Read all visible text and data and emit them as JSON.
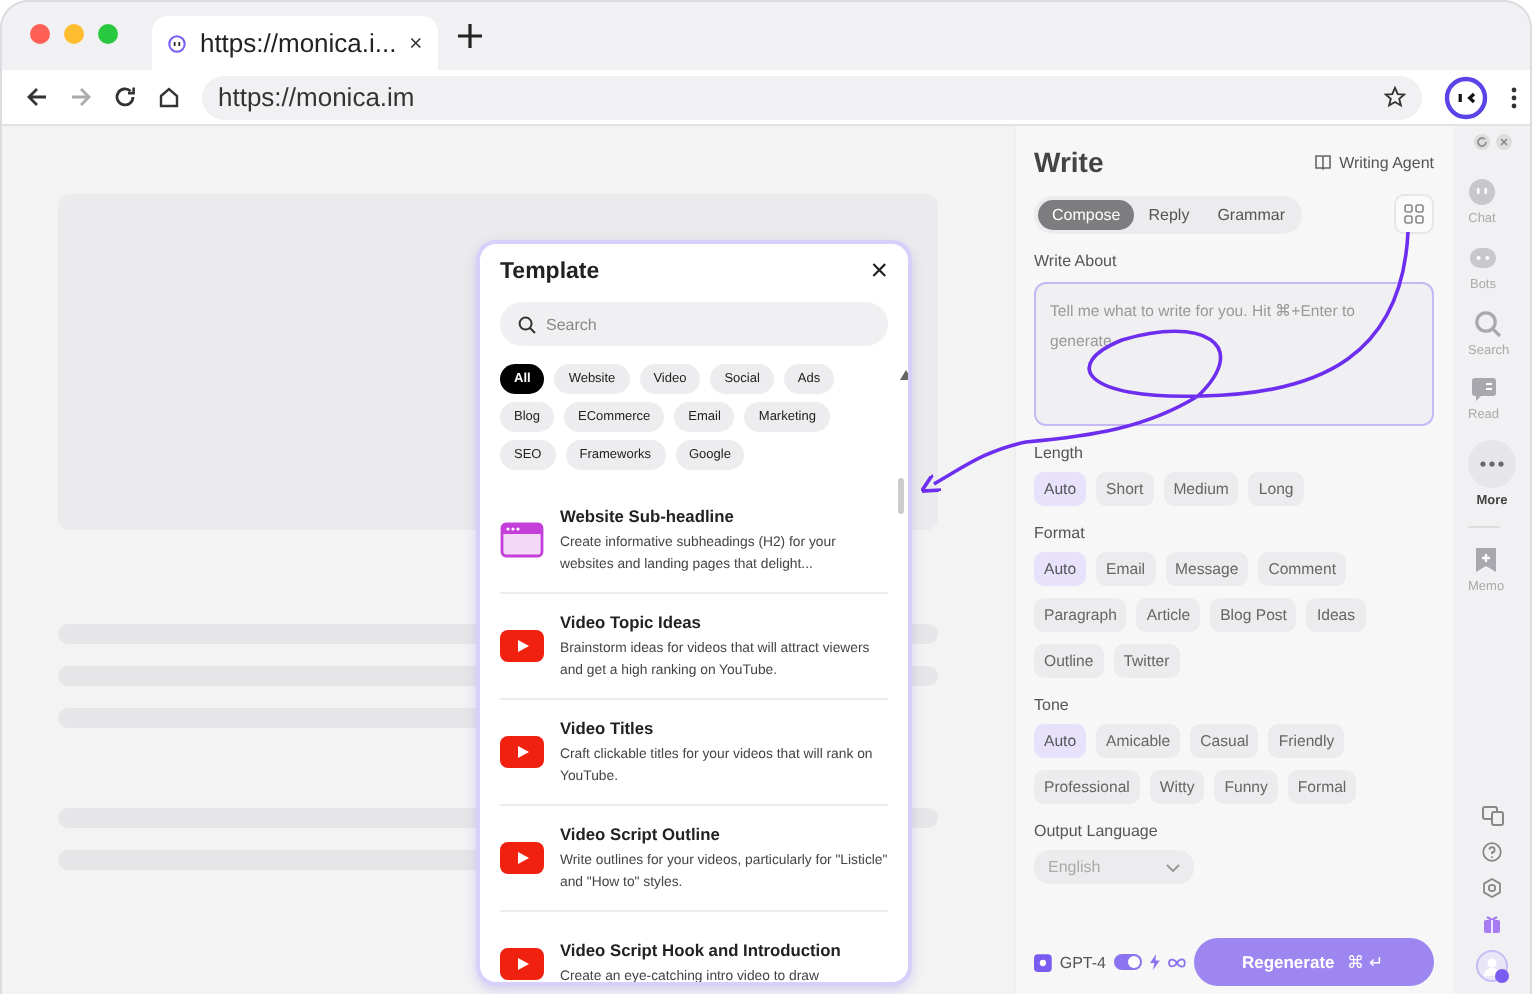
{
  "browser": {
    "tab_title": "https://monica.i...",
    "url": "https://monica.im"
  },
  "template_dialog": {
    "title": "Template",
    "close": "×",
    "search_placeholder": "Search",
    "filters": [
      {
        "label": "All",
        "selected": true
      },
      {
        "label": "Website",
        "selected": false
      },
      {
        "label": "Video",
        "selected": false
      },
      {
        "label": "Social",
        "selected": false
      },
      {
        "label": "Ads",
        "selected": false
      },
      {
        "label": "Blog",
        "selected": false
      },
      {
        "label": "ECommerce",
        "selected": false
      },
      {
        "label": "Email",
        "selected": false
      },
      {
        "label": "Marketing",
        "selected": false
      },
      {
        "label": "SEO",
        "selected": false
      },
      {
        "label": "Frameworks",
        "selected": false
      },
      {
        "label": "Google",
        "selected": false
      }
    ],
    "items": [
      {
        "kind": "website",
        "title": "Website Sub-headline",
        "description": "Create informative subheadings (H2) for your websites and landing pages that delight..."
      },
      {
        "kind": "video",
        "title": "Video Topic Ideas",
        "description": "Brainstorm ideas for videos that will attract viewers and get a high ranking on YouTube."
      },
      {
        "kind": "video",
        "title": "Video Titles",
        "description": "Craft clickable titles for your videos that will rank on YouTube."
      },
      {
        "kind": "video",
        "title": "Video Script Outline",
        "description": "Write outlines for your videos, particularly for \"Listicle\" and \"How to\" styles."
      },
      {
        "kind": "video",
        "title": "Video Script Hook and Introduction",
        "description": "Create an eye-catching intro video to draw"
      }
    ]
  },
  "write_panel": {
    "title": "Write",
    "agent_label": "Writing Agent",
    "modes": [
      {
        "label": "Compose",
        "selected": true
      },
      {
        "label": "Reply",
        "selected": false
      },
      {
        "label": "Grammar",
        "selected": false
      }
    ],
    "write_about": {
      "label": "Write About",
      "placeholder": "Tell me what to write for you. Hit ⌘+Enter to generate."
    },
    "option_groups": [
      {
        "label": "Length",
        "options": [
          {
            "label": "Auto",
            "selected": true
          },
          {
            "label": "Short",
            "selected": false
          },
          {
            "label": "Medium",
            "selected": false
          },
          {
            "label": "Long",
            "selected": false
          }
        ]
      },
      {
        "label": "Format",
        "options": [
          {
            "label": "Auto",
            "selected": true
          },
          {
            "label": "Email",
            "selected": false
          },
          {
            "label": "Message",
            "selected": false
          },
          {
            "label": "Comment",
            "selected": false
          },
          {
            "label": "Paragraph",
            "selected": false
          },
          {
            "label": "Article",
            "selected": false
          },
          {
            "label": "Blog Post",
            "selected": false
          },
          {
            "label": "Ideas",
            "selected": false
          },
          {
            "label": "Outline",
            "selected": false
          },
          {
            "label": "Twitter",
            "selected": false
          }
        ]
      },
      {
        "label": "Tone",
        "options": [
          {
            "label": "Auto",
            "selected": true
          },
          {
            "label": "Amicable",
            "selected": false
          },
          {
            "label": "Casual",
            "selected": false
          },
          {
            "label": "Friendly",
            "selected": false
          },
          {
            "label": "Professional",
            "selected": false
          },
          {
            "label": "Witty",
            "selected": false
          },
          {
            "label": "Funny",
            "selected": false
          },
          {
            "label": "Formal",
            "selected": false
          }
        ]
      }
    ],
    "output_language": {
      "label": "Output Language",
      "value": "English"
    },
    "footer": {
      "model": "GPT-4",
      "toggle_on": true,
      "button": "Regenerate",
      "button_disabled": true,
      "shortcut": "⌘ ↵"
    }
  },
  "sidebar": {
    "items": [
      {
        "kind": "chat",
        "label": "Chat",
        "selected": false
      },
      {
        "kind": "bots",
        "label": "Bots",
        "selected": false
      },
      {
        "kind": "search",
        "label": "Search",
        "selected": false
      },
      {
        "kind": "read",
        "label": "Read",
        "selected": false
      },
      {
        "kind": "more",
        "label": "More",
        "selected": true
      },
      {
        "kind": "memo",
        "label": "Memo",
        "selected": false
      }
    ]
  }
}
